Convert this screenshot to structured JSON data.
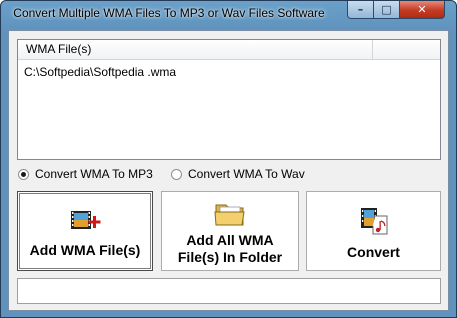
{
  "window": {
    "title": "Convert Multiple WMA Files To MP3 or Wav Files Software",
    "controls": {
      "minimize": "–",
      "maximize": "□",
      "close": "✕"
    }
  },
  "file_list": {
    "columns": [
      "WMA File(s)",
      ""
    ],
    "rows": [
      "C:\\Softpedia\\Softpedia .wma"
    ]
  },
  "options": {
    "mp3_label": "Convert WMA To MP3",
    "wav_label": "Convert WMA To Wav",
    "selected": "mp3"
  },
  "buttons": {
    "add_files": "Add WMA File(s)",
    "add_folder_line1": "Add All WMA",
    "add_folder_line2": "File(s) In Folder",
    "convert": "Convert"
  },
  "status": {
    "text": ""
  },
  "colors": {
    "title_bar": "#5f93bd",
    "close_button": "#c43b24",
    "client_bg": "#f0f0f0"
  }
}
